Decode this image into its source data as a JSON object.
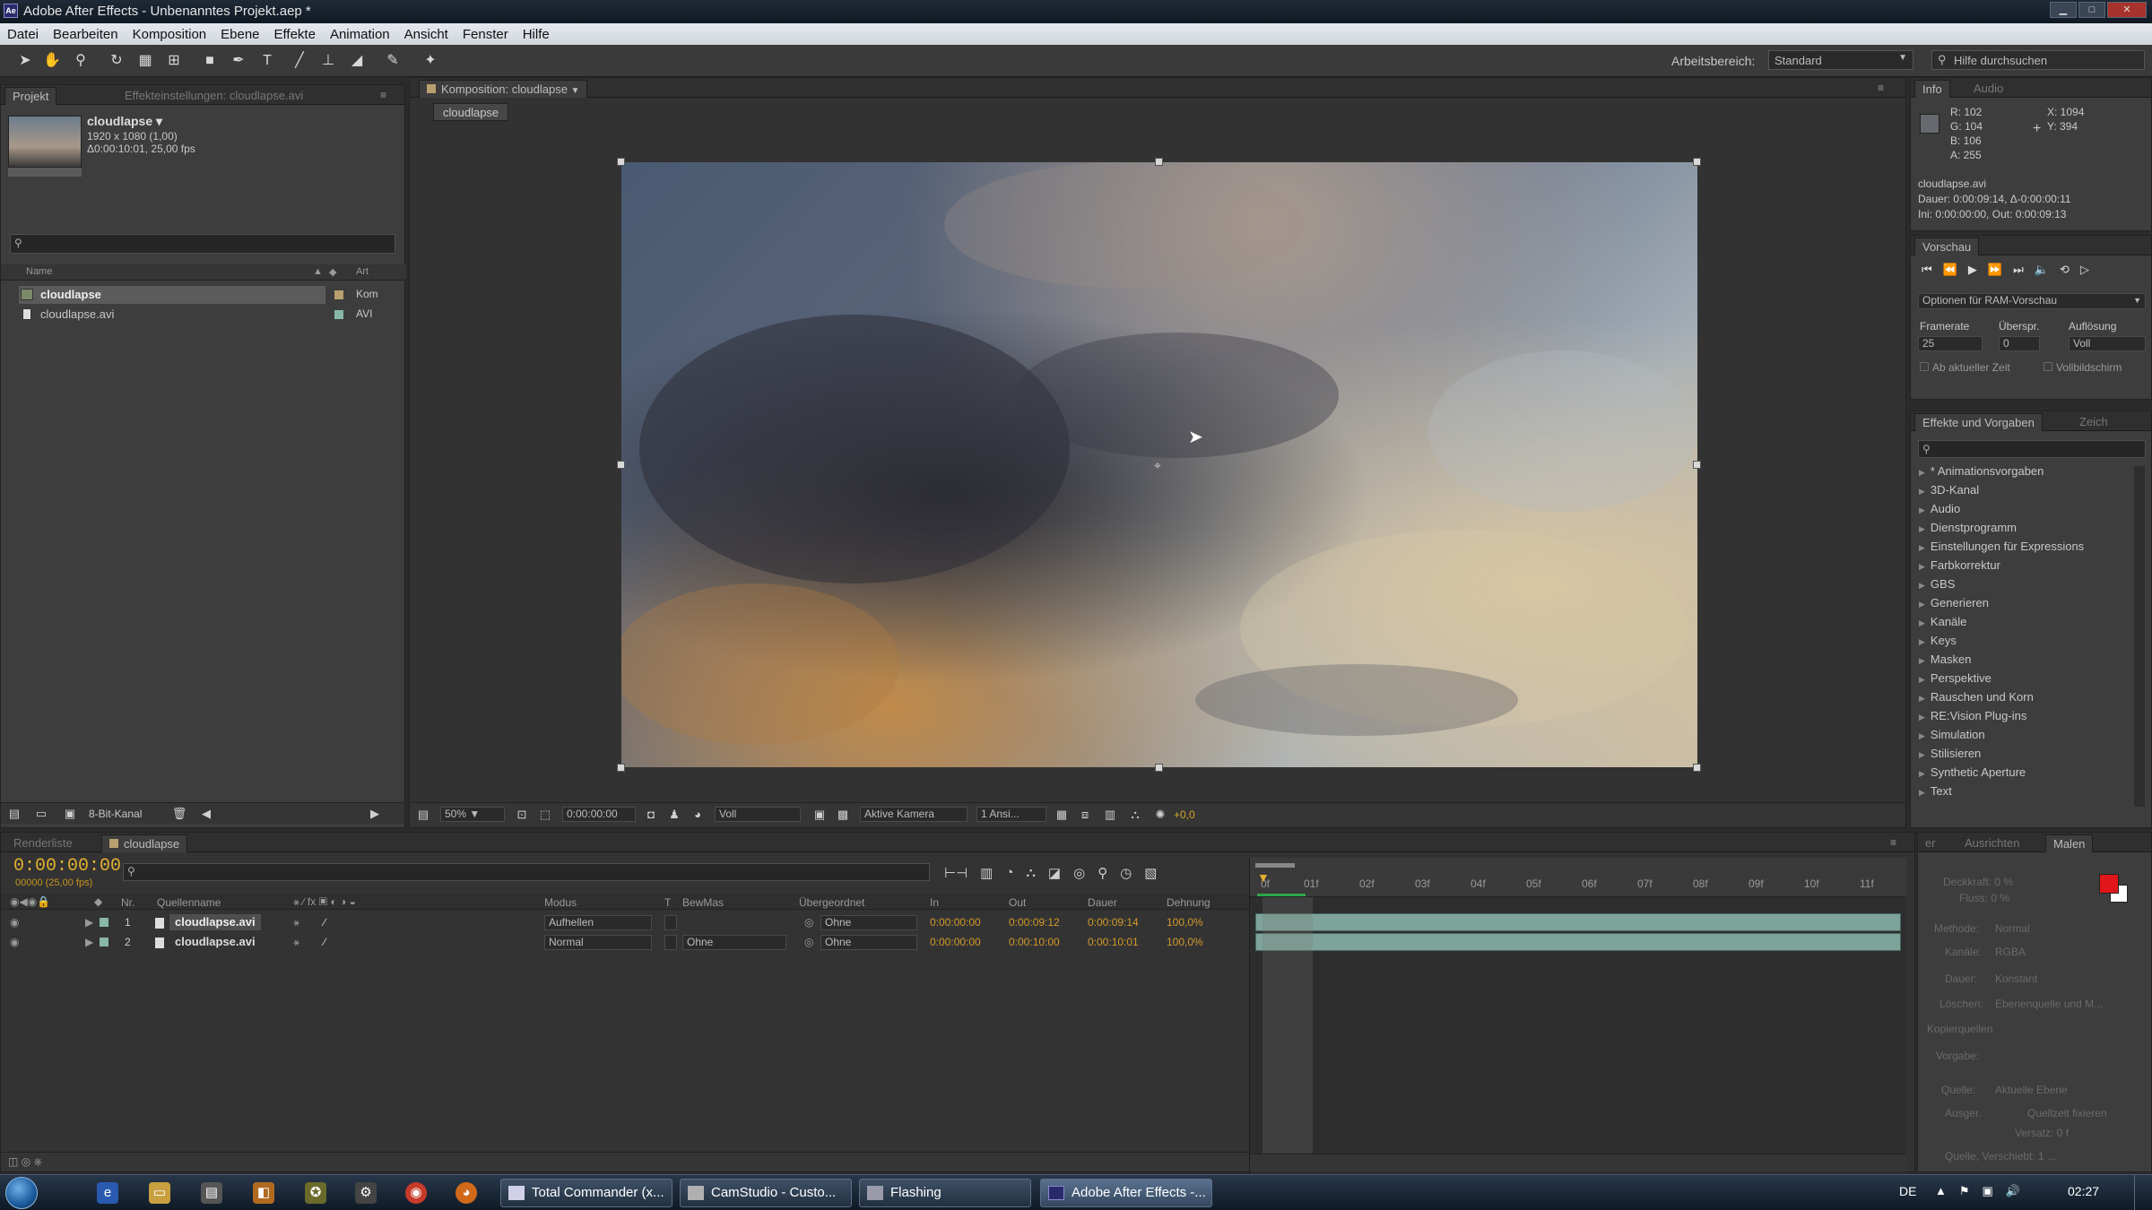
{
  "window": {
    "title": "Adobe After Effects - Unbenanntes Projekt.aep *",
    "app_icon": "Ae"
  },
  "menu": [
    "Datei",
    "Bearbeiten",
    "Komposition",
    "Ebene",
    "Effekte",
    "Animation",
    "Ansicht",
    "Fenster",
    "Hilfe"
  ],
  "toolbar": {
    "workspace_label": "Arbeitsbereich:",
    "workspace_value": "Standard",
    "help_placeholder": "Hilfe durchsuchen"
  },
  "project": {
    "tab": "Projekt",
    "tab2": "Effekteinstellungen: cloudlapse.avi",
    "item_name": "cloudlapse ▾",
    "item_res": "1920 x 1080 (1,00)",
    "item_duration": "Δ0:00:10:01, 25,00 fps",
    "search_placeholder": "",
    "col_name": "Name",
    "col_type": "Art",
    "items": [
      {
        "name": "cloudlapse",
        "type": "Kom"
      },
      {
        "name": "cloudlapse.avi",
        "type": "AVI"
      }
    ],
    "bit_depth": "8-Bit-Kanal"
  },
  "composition": {
    "tab": "Komposition: cloudlapse",
    "breadcrumb": "cloudlapse",
    "zoom": "50%",
    "timecode": "0:00:00:00",
    "resolution": "Voll",
    "camera": "Aktive Kamera",
    "views": "1 Ansi...",
    "exposure": "+0,0"
  },
  "info": {
    "tab": "Info",
    "tab2": "Audio",
    "r": "R: 102",
    "g": "G: 104",
    "b": "B: 106",
    "a": "A: 255",
    "x": "X: 1094",
    "y": "Y: 394",
    "file": "cloudlapse.avi",
    "duration": "Dauer: 0:00:09:14, Δ-0:00:00:11",
    "inout": "Ini: 0:00:00:00, Out: 0:00:09:13"
  },
  "preview": {
    "tab": "Vorschau",
    "ram_options": "Optionen für RAM-Vorschau",
    "framerate_label": "Framerate",
    "skip_label": "Überspr.",
    "resolution_label": "Auflösung",
    "framerate": "25",
    "skip": "0",
    "resolution": "Voll",
    "from_current": "Ab aktueller Zeit",
    "fullscreen": "Vollbildschirm"
  },
  "effects": {
    "tab": "Effekte und Vorgaben",
    "tab2": "Zeich",
    "items": [
      "* Animationsvorgaben",
      "3D-Kanal",
      "Audio",
      "Dienstprogramm",
      "Einstellungen für Expressions",
      "Farbkorrektur",
      "GBS",
      "Generieren",
      "Kanäle",
      "Keys",
      "Masken",
      "Perspektive",
      "Rauschen und Korn",
      "RE:Vision Plug-ins",
      "Simulation",
      "Stilisieren",
      "Synthetic Aperture",
      "Text"
    ]
  },
  "timeline": {
    "tab1": "Renderliste",
    "tab2": "cloudlapse",
    "timecode": "0:00:00:00",
    "frames": "00000 (25,00 fps)",
    "columns": {
      "nr": "Nr.",
      "source": "Quellenname",
      "mode": "Modus",
      "t": "T",
      "trkmat": "BewMas",
      "parent": "Übergeordnet",
      "in": "In",
      "out": "Out",
      "duration": "Dauer",
      "stretch": "Dehnung"
    },
    "ruler": [
      "0f",
      "01f",
      "02f",
      "03f",
      "04f",
      "05f",
      "06f",
      "07f",
      "08f",
      "09f",
      "10f",
      "11f"
    ],
    "layers": [
      {
        "nr": "1",
        "name": "cloudlapse.avi",
        "mode": "Aufhellen",
        "trkmat": "",
        "parent": "Ohne",
        "in": "0:00:00:00",
        "out": "0:00:09:12",
        "duration": "0:00:09:14",
        "stretch": "100,0%"
      },
      {
        "nr": "2",
        "name": "cloudlapse.avi",
        "mode": "Normal",
        "trkmat": "Ohne",
        "parent": "Ohne",
        "in": "0:00:00:00",
        "out": "0:00:10:00",
        "duration": "0:00:10:01",
        "stretch": "100,0%"
      }
    ]
  },
  "paint": {
    "tab1": "er",
    "tab2": "Ausrichten",
    "tab3": "Malen",
    "opacity": "Deckkraft: 0 %",
    "flow": "Fluss: 0 %",
    "mode_label": "Methode:",
    "mode_value": "Normal",
    "channels_label": "Kanäle:",
    "channels_value": "RGBA",
    "duration_label": "Dauer:",
    "duration_value": "Konstant",
    "erase_label": "Löschen:",
    "erase_value": "Ebenenquelle und M...",
    "clone_label": "Kopierquellen",
    "preset_label": "Vorgabe:",
    "source_label": "Quelle:",
    "source_value": "Aktuelle Ebene",
    "aligned": "Ausger.",
    "lock_source": "Quellzeit fixieren",
    "offset": "Versatz: 0 f",
    "source_time": "Quelle, Verschiebt: 1 ...",
    "fg_color": "#e0161a",
    "bg_color": "#ffffff"
  },
  "taskbar": {
    "buttons": [
      "Total Commander (x...",
      "CamStudio - Custo...",
      "Flashing",
      "Adobe After Effects -..."
    ],
    "lang": "DE",
    "clock": "02:27"
  }
}
